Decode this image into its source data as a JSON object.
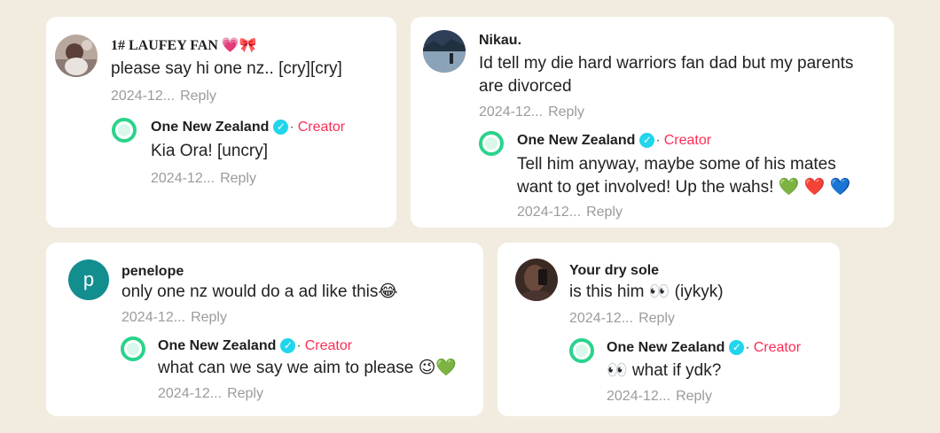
{
  "cards": [
    {
      "user": {
        "name": "1# LAUFEY FAN 💗🎀",
        "text": "please say hi one nz.. [cry][cry]",
        "time": "2024-12...",
        "reply": "Reply"
      },
      "creator": {
        "name": "One New Zealand",
        "badge": "✓",
        "dot": "·",
        "tag": "Creator",
        "text": "Kia Ora! [uncry]",
        "time": "2024-12...",
        "reply": "Reply"
      }
    },
    {
      "user": {
        "name": "Nikau.",
        "text_line1": "Id tell my die hard warriors fan dad but my parents",
        "text_line2": "are divorced",
        "time": "2024-12...",
        "reply": "Reply"
      },
      "creator": {
        "name": "One New Zealand",
        "badge": "✓",
        "dot": "·",
        "tag": "Creator",
        "text_line1": "Tell him anyway, maybe some of his mates",
        "text_line2": "want to get involved! Up the wahs! 💚 ❤️ 💙",
        "time": "2024-12...",
        "reply": "Reply"
      }
    },
    {
      "user": {
        "name": "penelope",
        "avatar_letter": "p",
        "text": "only one nz would do a ad like this😂",
        "time": "2024-12...",
        "reply": "Reply"
      },
      "creator": {
        "name": "One New Zealand",
        "badge": "✓",
        "dot": "·",
        "tag": "Creator",
        "text": "what can we say we aim to please 😉💚",
        "time": "2024-12...",
        "reply": "Reply"
      }
    },
    {
      "user": {
        "name": "Your dry sole",
        "text": "is this him 👀 (iykyk)",
        "time": "2024-12...",
        "reply": "Reply"
      },
      "creator": {
        "name": "One New Zealand",
        "badge": "✓",
        "dot": "·",
        "tag": "Creator",
        "text": "👀 what if ydk?",
        "time": "2024-12...",
        "reply": "Reply"
      }
    }
  ],
  "colors": {
    "background": "#f2ebe0",
    "card": "#ffffff",
    "creator_tag": "#fe2c55",
    "verified": "#20d5ec",
    "ring": "#2bd38c",
    "meta": "#9b9b9b"
  },
  "icons": {
    "verified": "verified-badge-icon",
    "creator_avatar": "one-nz-ring-avatar"
  }
}
